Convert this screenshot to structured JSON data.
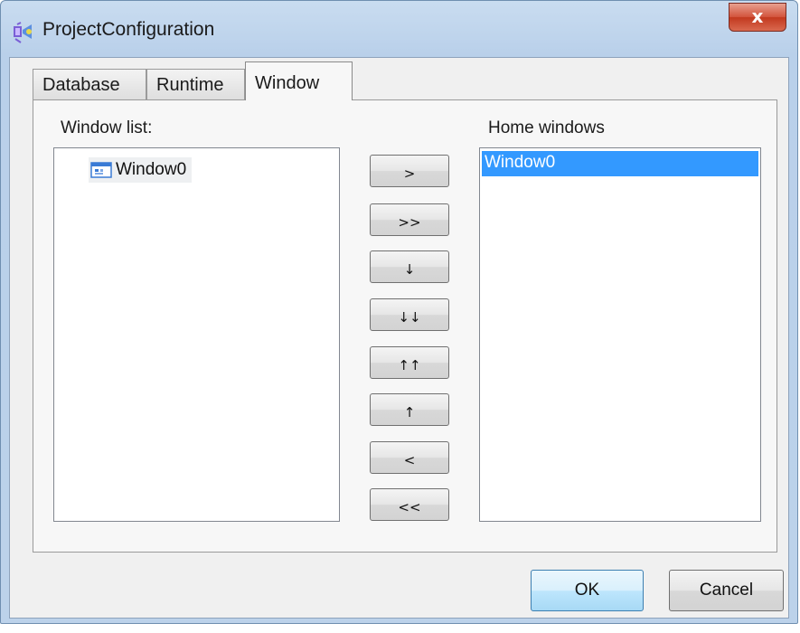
{
  "window": {
    "title": "ProjectConfiguration",
    "close_symbol": "x"
  },
  "tabs": [
    {
      "label": "Database",
      "active": false
    },
    {
      "label": "Runtime",
      "active": false
    },
    {
      "label": "Window",
      "active": true
    }
  ],
  "window_list": {
    "label": "Window list:",
    "items": [
      {
        "label": "Window0",
        "icon": "window-icon"
      }
    ]
  },
  "home_windows": {
    "label": "Home windows",
    "items": [
      {
        "label": "Window0",
        "selected": true
      }
    ]
  },
  "move_buttons": [
    {
      "label": ">",
      "name": "add-button"
    },
    {
      "label": ">>",
      "name": "add-all-button"
    },
    {
      "label": "↓",
      "name": "move-down-button"
    },
    {
      "label": "↓↓",
      "name": "move-bottom-button"
    },
    {
      "label": "↑↑",
      "name": "move-top-button"
    },
    {
      "label": "↑",
      "name": "move-up-button"
    },
    {
      "label": "<",
      "name": "remove-button"
    },
    {
      "label": "<<",
      "name": "remove-all-button"
    }
  ],
  "dialog_buttons": {
    "ok": "OK",
    "cancel": "Cancel"
  },
  "colors": {
    "selection": "#3399ff",
    "title_bar": "#b9d0ea",
    "close_button": "#c2391f"
  }
}
